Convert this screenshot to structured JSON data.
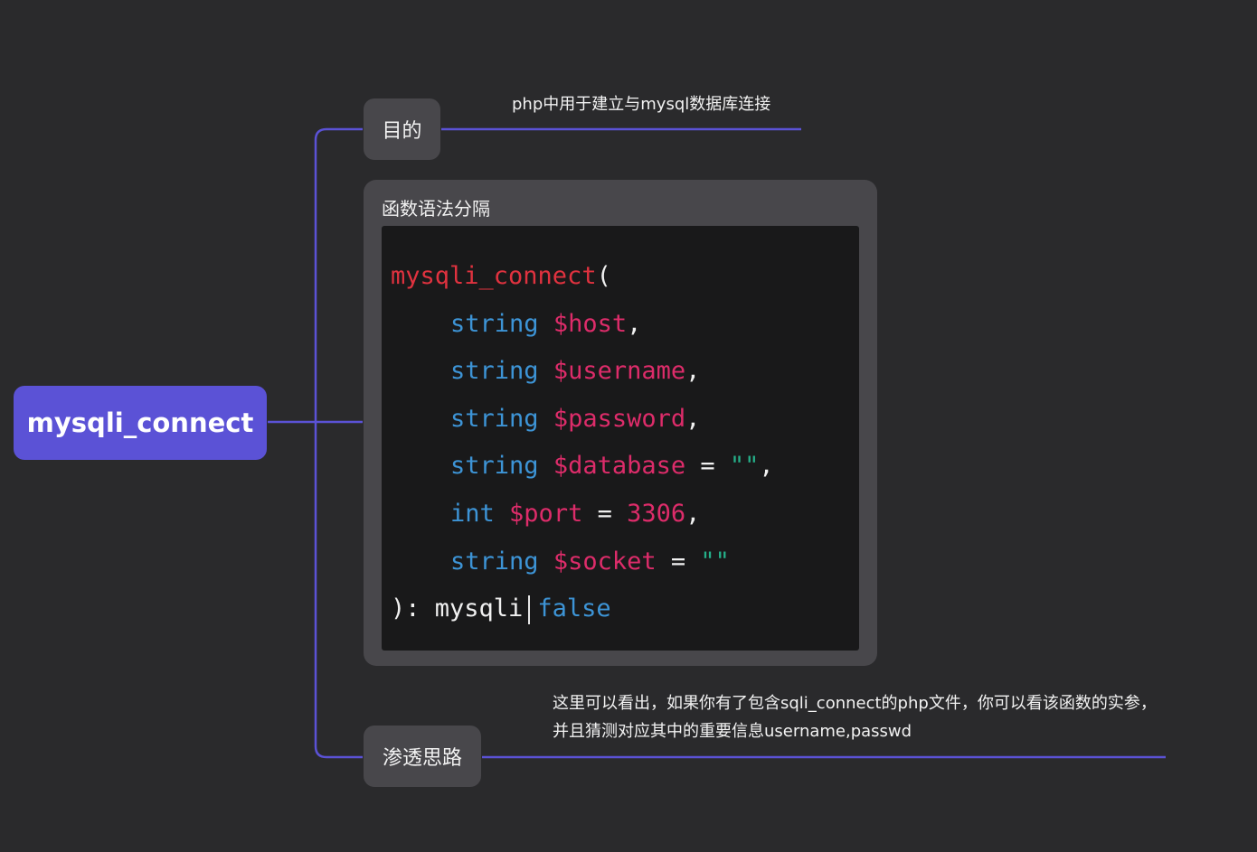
{
  "root": {
    "label": "mysqli_connect"
  },
  "topics": {
    "purpose": {
      "label": "目的",
      "note": "php中用于建立与mysql数据库连接"
    },
    "syntax": {
      "label": "函数语法分隔",
      "code": {
        "open": {
          "fn": "mysqli_connect",
          "paren": "("
        },
        "params": [
          {
            "type": "string",
            "var": "$host",
            "default": "",
            "tail": ","
          },
          {
            "type": "string",
            "var": "$username",
            "default": "",
            "tail": ","
          },
          {
            "type": "string",
            "var": "$password",
            "default": "",
            "tail": ","
          },
          {
            "type": "string",
            "var": "$database",
            "eq": " = ",
            "default": "\"\"",
            "tail": ","
          },
          {
            "type": "int",
            "var": "$port",
            "eq": " = ",
            "default": "3306",
            "tail": ","
          },
          {
            "type": "string",
            "var": "$socket",
            "eq": " = ",
            "default": "\"\"",
            "tail": ""
          }
        ],
        "close": {
          "prefix": "): mysqli",
          "ret": "false"
        }
      }
    },
    "approach": {
      "label": "渗透思路",
      "note": "这里可以看出，如果你有了包含sqli_connect的php文件，你可以看该函数的实参，并且猜测对应其中的重要信息username,passwd"
    }
  },
  "colors": {
    "background": "#2a2a2c",
    "root": "#5b52d6",
    "topic": "#48474b",
    "connector": "#5b52d6",
    "code_bg": "#19191a",
    "code_function": "#e0323f",
    "code_keyword": "#3d94d6",
    "code_variable": "#dd2c6a",
    "code_string": "#25b08a"
  }
}
